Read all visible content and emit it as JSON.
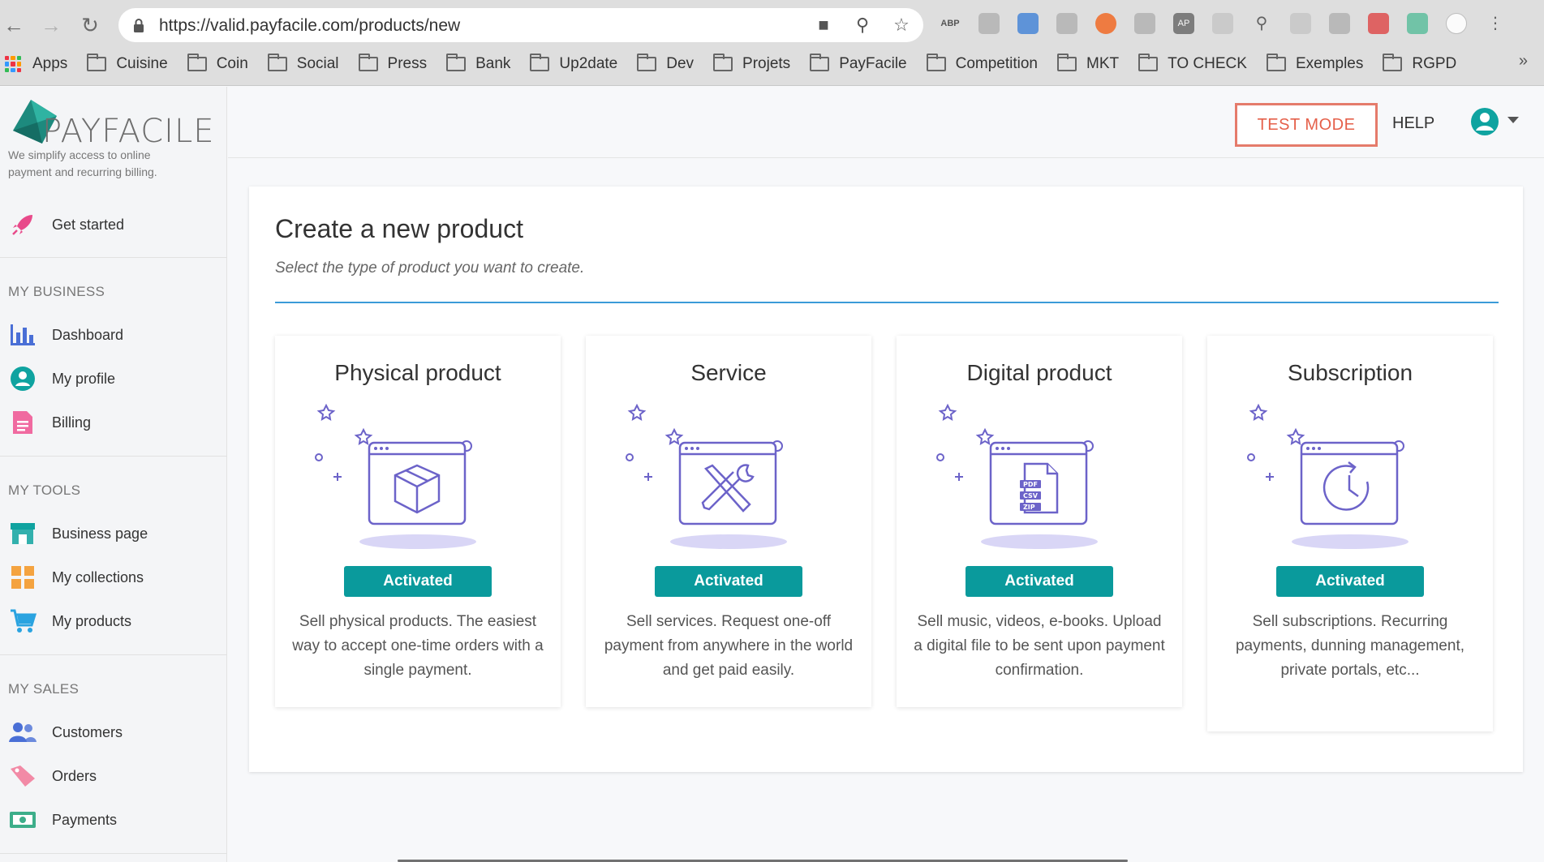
{
  "browser": {
    "url": "https://valid.payfacile.com/products/new",
    "bookmarks": [
      "Apps",
      "Cuisine",
      "Coin",
      "Social",
      "Press",
      "Bank",
      "Up2date",
      "Dev",
      "Projets",
      "PayFacile",
      "Competition",
      "MKT",
      "TO CHECK",
      "Exemples",
      "RGPD"
    ],
    "extensions": [
      "ABP",
      "AP"
    ]
  },
  "sidebar": {
    "brand": "PAYFACILE",
    "tagline": "We simplify access to online payment and recurring billing.",
    "get_started": "Get started",
    "sections": {
      "business": "MY BUSINESS",
      "tools": "MY TOOLS",
      "sales": "MY SALES"
    },
    "business_items": [
      "Dashboard",
      "My profile",
      "Billing"
    ],
    "tools_items": [
      "Business page",
      "My collections",
      "My products"
    ],
    "sales_items": [
      "Customers",
      "Orders",
      "Payments"
    ]
  },
  "header": {
    "test_mode": "TEST MODE",
    "help": "HELP"
  },
  "main": {
    "title": "Create a new product",
    "subtitle": "Select the type of product you want to create.",
    "types": [
      {
        "name": "Physical product",
        "badge": "Activated",
        "desc": "Sell physical products. The easiest way to accept one-time orders with a single payment."
      },
      {
        "name": "Service",
        "badge": "Activated",
        "desc": "Sell services. Request one-off payment from anywhere in the world and get paid easily."
      },
      {
        "name": "Digital product",
        "badge": "Activated",
        "desc": "Sell music, videos, e-books. Upload a digital file to be sent upon payment confirmation."
      },
      {
        "name": "Subscription",
        "badge": "Activated",
        "desc": "Sell subscriptions. Recurring payments, dunning management, private portals, etc..."
      }
    ],
    "file_labels": [
      "PDF",
      "CSV",
      "ZIP"
    ]
  },
  "colors": {
    "accent": "#0a9a9c",
    "test_mode": "#e5604a",
    "rule": "#3b9bd8",
    "illustration": "#6c63c9"
  }
}
